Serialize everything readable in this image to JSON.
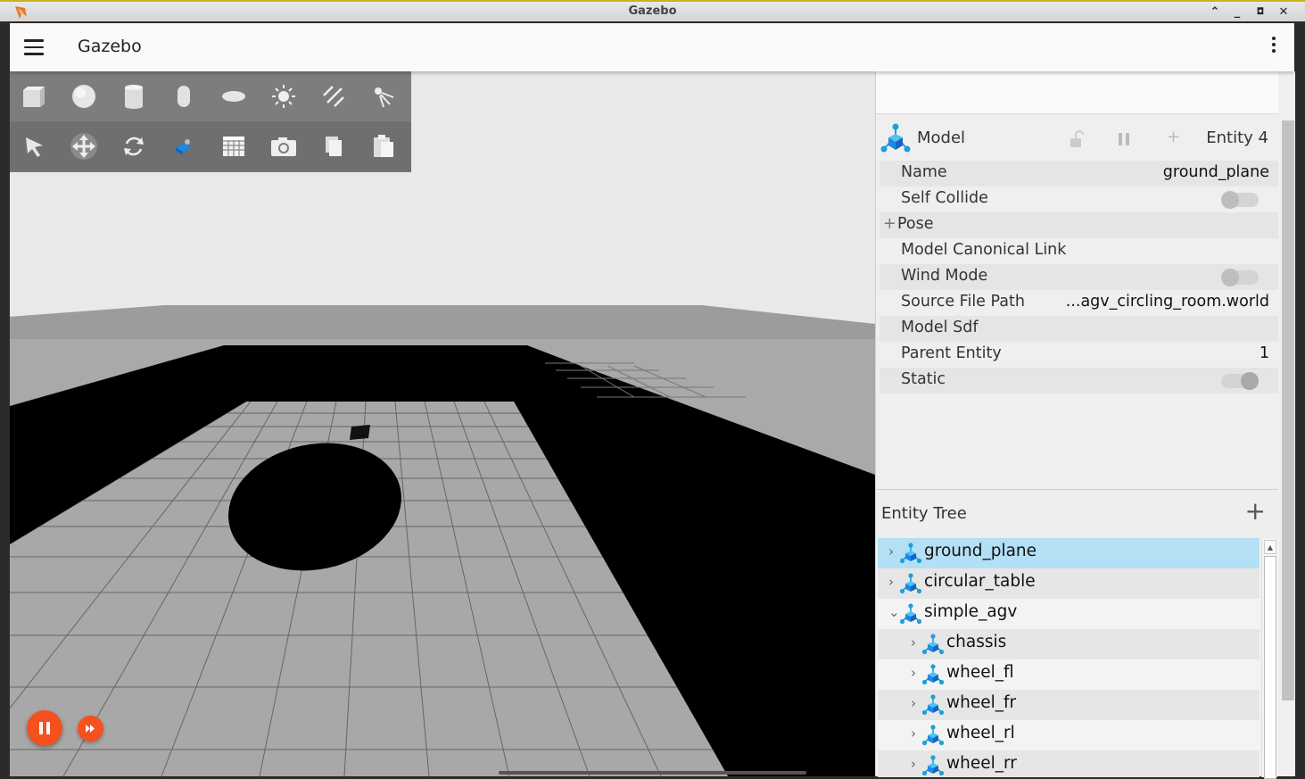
{
  "window": {
    "title": "Gazebo"
  },
  "app": {
    "title": "Gazebo"
  },
  "toolbar": {
    "row1": [
      "box-icon",
      "sphere-icon",
      "cylinder-icon",
      "capsule-icon",
      "ellipsoid-icon",
      "sun-light-icon",
      "directional-light-icon",
      "spot-light-icon"
    ],
    "row2": [
      "select-arrow-icon",
      "translate-icon",
      "rotate-icon",
      "view-angle-icon",
      "grid-snap-icon",
      "screenshot-icon",
      "copy-icon",
      "paste-icon"
    ]
  },
  "inspector": {
    "type": "Model",
    "entity": "Entity 4",
    "properties": [
      {
        "key": "Name",
        "value": "ground_plane"
      },
      {
        "key": "Self Collide",
        "toggle": "off"
      },
      {
        "key": "Pose",
        "expandable": true
      },
      {
        "key": "Model Canonical Link",
        "value": ""
      },
      {
        "key": "Wind Mode",
        "toggle": "off"
      },
      {
        "key": "Source File Path",
        "value": "...agv_circling_room.world"
      },
      {
        "key": "Model Sdf",
        "value": ""
      },
      {
        "key": "Parent Entity",
        "value": "1"
      },
      {
        "key": "Static",
        "toggle": "on"
      }
    ],
    "pose_prefix": "+"
  },
  "entity_tree": {
    "title": "Entity Tree",
    "add_label": "+",
    "items": [
      {
        "label": "ground_plane",
        "depth": 0,
        "expanded": false,
        "selected": true
      },
      {
        "label": "circular_table",
        "depth": 0,
        "expanded": false,
        "selected": false
      },
      {
        "label": "simple_agv",
        "depth": 0,
        "expanded": true,
        "selected": false
      },
      {
        "label": "chassis",
        "depth": 1,
        "expanded": false,
        "selected": false
      },
      {
        "label": "wheel_fl",
        "depth": 1,
        "expanded": false,
        "selected": false
      },
      {
        "label": "wheel_fr",
        "depth": 1,
        "expanded": false,
        "selected": false
      },
      {
        "label": "wheel_rl",
        "depth": 1,
        "expanded": false,
        "selected": false
      },
      {
        "label": "wheel_rr",
        "depth": 1,
        "expanded": false,
        "selected": false
      }
    ]
  },
  "playback": {
    "state": "paused"
  },
  "colors": {
    "accent": "#f4511e",
    "selection": "#b3e0f5",
    "entity_icon": "#1e9fd6"
  }
}
